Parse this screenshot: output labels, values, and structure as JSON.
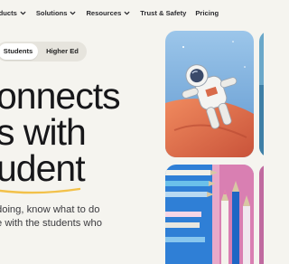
{
  "nav": {
    "items": [
      {
        "label": "roducts",
        "has_dropdown": true
      },
      {
        "label": "Solutions",
        "has_dropdown": true
      },
      {
        "label": "Resources",
        "has_dropdown": true
      },
      {
        "label": "Trust & Safety",
        "has_dropdown": false
      },
      {
        "label": "Pricing",
        "has_dropdown": false
      }
    ]
  },
  "audience_toggle": {
    "options": [
      "Students",
      "Higher Ed"
    ],
    "selected": "Students"
  },
  "hero": {
    "headline_lines": [
      "onnects",
      "s with",
      "udent"
    ],
    "subtext_lines": [
      "doing, know what to do",
      "e with the students who"
    ]
  },
  "images": [
    {
      "name": "astronaut-illustration"
    },
    {
      "name": "colored-pencils-photo"
    }
  ],
  "colors": {
    "background": "#f5f4ef",
    "underline_accent": "#f2c14a",
    "astronaut_sky": "#7fb4e0",
    "mars_orange": "#e0704a",
    "pencil_pink": "#e6a9c9",
    "pencil_blue": "#2f7fd6"
  }
}
